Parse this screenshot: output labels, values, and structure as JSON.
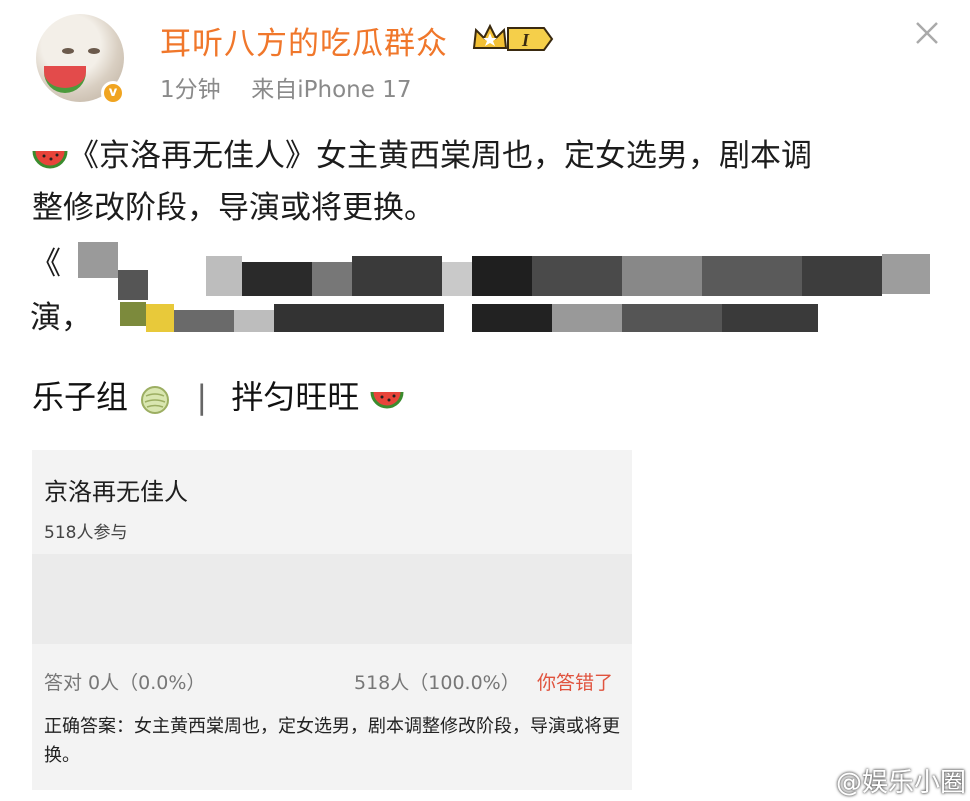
{
  "header": {
    "username": "耳听八方的吃瓜群众",
    "level_badge": "I",
    "time": "1分钟",
    "source": "来自iPhone 17"
  },
  "post": {
    "line1": "《京洛再无佳人》女主黄西棠周也，定女选男，剧本调",
    "line2": "整修改阶段，导演或将更换。",
    "blurred_prefix_1": "《",
    "blurred_prefix_2": "演，"
  },
  "card": {
    "group_name": "乐子组",
    "separator": "|",
    "sub_name": "拌匀旺旺"
  },
  "quiz": {
    "title": "京洛再无佳人",
    "participants": "518人参与",
    "correct_stat": "答对  0人（0.0%）",
    "wrong_stat": "518人（100.0%）",
    "wrong_label": "你答错了",
    "answer": "正确答案：女主黄西棠周也，定女选男，剧本调整修改阶段，导演或将更换。"
  },
  "watermark": {
    "text": "@娱乐小圈"
  },
  "icons": [
    "avatar",
    "verified-badge-icon",
    "crown-level-icon",
    "close-icon",
    "watermelon-icon",
    "melon-icon",
    "weibo-logo-icon"
  ],
  "colors": {
    "username": "#f0772b",
    "wrong": "#e0533e",
    "verified": "#f0a420"
  }
}
